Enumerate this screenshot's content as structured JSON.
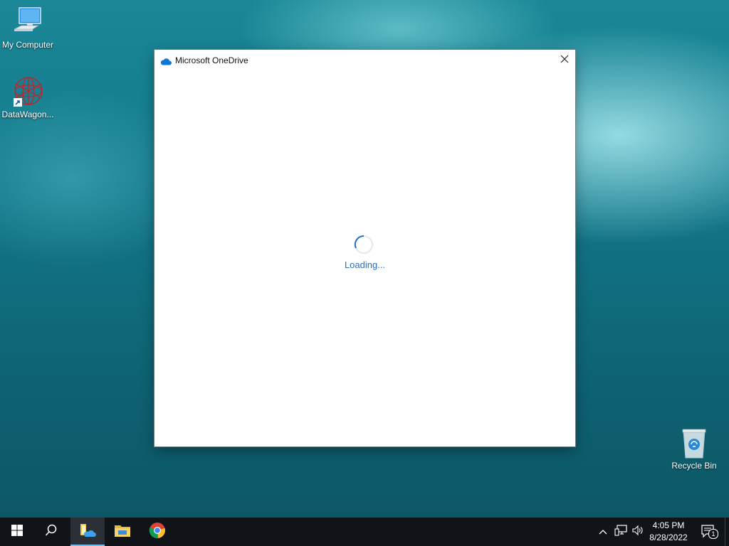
{
  "desktop": {
    "icons": [
      {
        "label": "My Computer",
        "icon": "computer-icon"
      },
      {
        "label": "DataWagon...",
        "icon": "datawagon-shortcut-icon"
      },
      {
        "label": "Recycle Bin",
        "icon": "recycle-bin-icon"
      }
    ]
  },
  "window": {
    "title": "Microsoft OneDrive",
    "title_icon": "onedrive-cloud-icon",
    "close_icon": "close-icon",
    "loading_text": "Loading..."
  },
  "taskbar": {
    "buttons": [
      "windows-start-icon",
      "search-icon",
      "onedrive-app-icon",
      "file-explorer-icon",
      "chrome-icon"
    ],
    "tray_icons": [
      "chevron-up-icon",
      "network-icon",
      "volume-icon"
    ],
    "clock": {
      "time": "4:05 PM",
      "date": "8/28/2022"
    },
    "notification_count": "1"
  },
  "colors": {
    "accent": "#2a70b8",
    "onedrive_blue": "#0f78d4",
    "taskbar": "#101418"
  }
}
